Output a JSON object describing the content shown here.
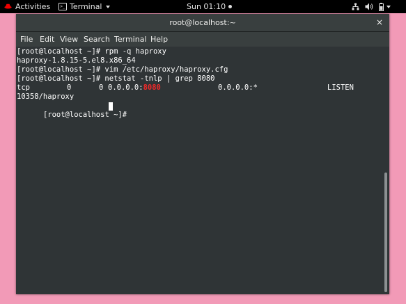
{
  "topbar": {
    "activities_label": "Activities",
    "app_label": "Terminal",
    "app_icon_glyph": ">_",
    "clock": "Sun 01:10"
  },
  "window": {
    "title": "root@localhost:~",
    "close_glyph": "×",
    "menu": [
      "File",
      "Edit",
      "View",
      "Search",
      "Terminal",
      "Help"
    ]
  },
  "terminal": {
    "lines": [
      "[root@localhost ~]# rpm -q haproxy",
      "haproxy-1.8.15-5.el8.x86_64",
      "[root@localhost ~]# vim /etc/haproxy/haproxy.cfg",
      "[root@localhost ~]# netstat -tnlp | grep 8080"
    ],
    "netstat_row": {
      "proto": "tcp",
      "recvq": "0",
      "sendq": "0",
      "local_prefix": "0.0.0.0:",
      "local_port_match": "8080",
      "foreign": "0.0.0.0:*",
      "state": "LISTEN"
    },
    "pid_line": "10358/haproxy",
    "prompt": "[root@localhost ~]#"
  },
  "colors": {
    "desktop_background": "#f29ab7",
    "terminal_background": "#2f3436",
    "grep_highlight": "#ef2929"
  },
  "icons": [
    "redhat-logo-icon",
    "terminal-app-icon",
    "recording-dot-icon",
    "network-icon",
    "volume-icon",
    "battery-icon",
    "system-menu-arrow-icon"
  ]
}
